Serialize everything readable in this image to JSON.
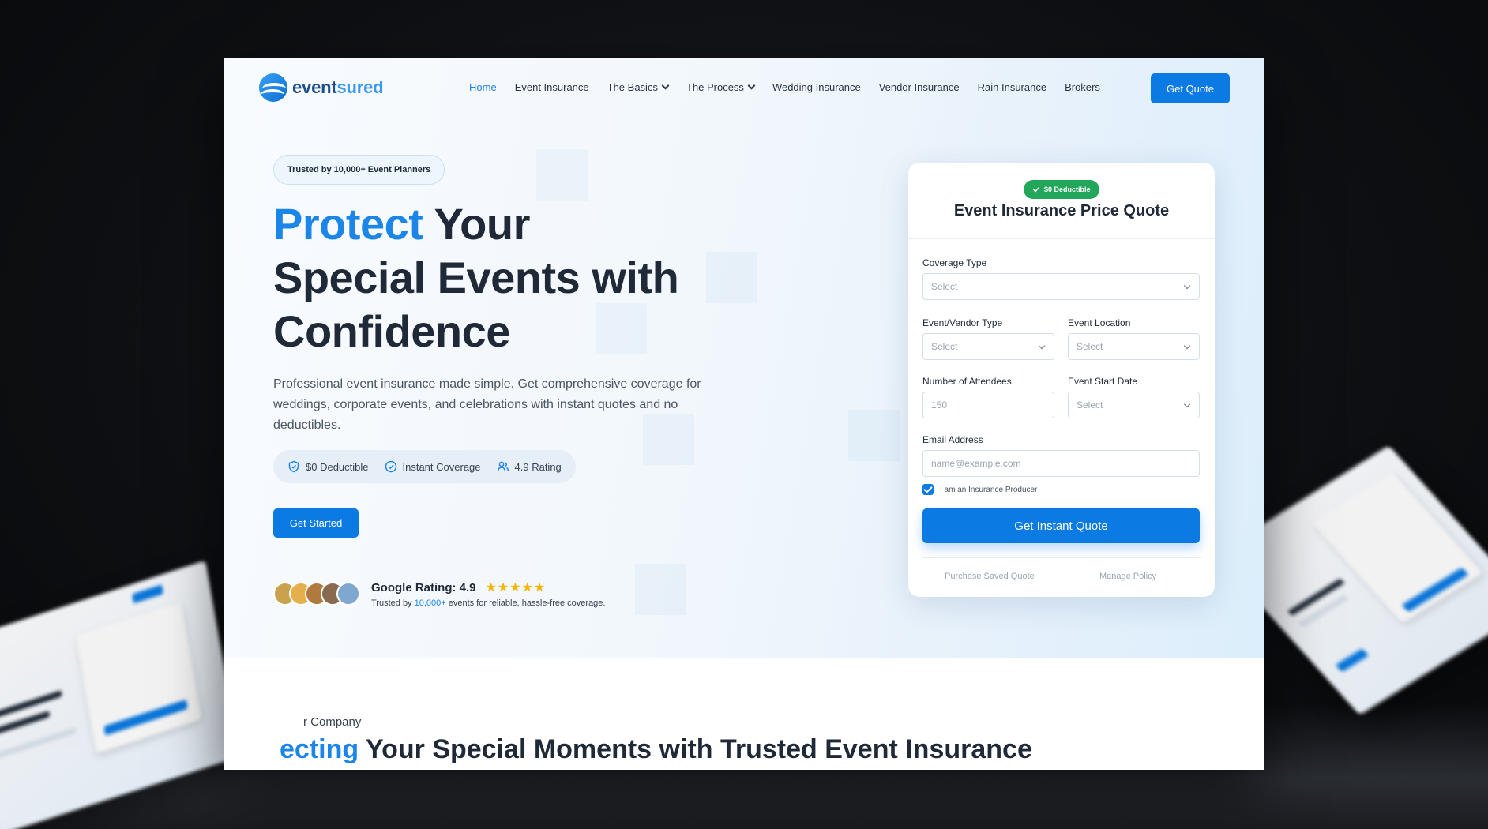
{
  "nav": {
    "logo_part1": "event",
    "logo_part2": "sured",
    "items": [
      {
        "label": "Home",
        "active": true,
        "dropdown": false
      },
      {
        "label": "Event Insurance",
        "active": false,
        "dropdown": false
      },
      {
        "label": "The Basics",
        "active": false,
        "dropdown": true
      },
      {
        "label": "The Process",
        "active": false,
        "dropdown": true
      },
      {
        "label": "Wedding Insurance",
        "active": false,
        "dropdown": false
      },
      {
        "label": "Vendor Insurance",
        "active": false,
        "dropdown": false
      },
      {
        "label": "Rain Insurance",
        "active": false,
        "dropdown": false
      },
      {
        "label": "Brokers",
        "active": false,
        "dropdown": false
      }
    ],
    "cta": "Get Quote"
  },
  "hero": {
    "badge": "Trusted by 10,000+ Event Planners",
    "headline_highlight": "Protect",
    "headline_rest1": " Your",
    "headline_line2": "Special Events with",
    "headline_line3": "Confidence",
    "description": "Professional event insurance made simple. Get comprehensive coverage for weddings, corporate events, and celebrations with instant quotes and no deductibles.",
    "features": [
      {
        "icon": "shield-check-icon",
        "label": "$0 Deductible"
      },
      {
        "icon": "check-circle-icon",
        "label": "Instant Coverage"
      },
      {
        "icon": "users-icon",
        "label": "4.9 Rating"
      }
    ],
    "cta": "Get Started",
    "rating": {
      "title": "Google Rating: 4.9",
      "stars": "★★★★★",
      "sub_prefix": "Trusted by ",
      "sub_highlight": "10,000+",
      "sub_suffix": " events for reliable, hassle-free coverage."
    }
  },
  "quote_card": {
    "badge": "$0 Deductible",
    "title": "Event Insurance Price Quote",
    "coverage_label": "Coverage Type",
    "coverage_value": "Select",
    "vendor_label": "Event/Vendor Type",
    "vendor_value": "Select",
    "location_label": "Event Location",
    "location_value": "Select",
    "attendees_label": "Number of Attendees",
    "attendees_placeholder": "150",
    "start_label": "Event Start Date",
    "start_value": "Select",
    "email_label": "Email Address",
    "email_placeholder": "name@example.com",
    "producer_label": "I am an Insurance Producer",
    "producer_checked": true,
    "submit": "Get Instant Quote",
    "link_saved": "Purchase Saved Quote",
    "link_manage": "Manage Policy"
  },
  "lower": {
    "eyebrow": "r Company",
    "title_highlight": "ecting",
    "title_rest": " Your Special Moments with Trusted Event Insurance"
  },
  "colors": {
    "brand": "#0b7be3",
    "accent_text": "#1c86e8",
    "success": "#22a65a",
    "star": "#f4b400"
  }
}
